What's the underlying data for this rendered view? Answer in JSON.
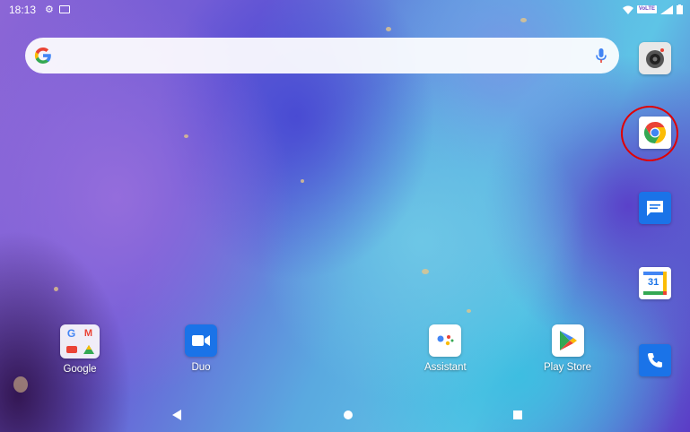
{
  "status_bar": {
    "time": "18:13",
    "icons": [
      "gear-icon",
      "message-icon",
      "wifi-icon",
      "volte-icon",
      "signal-icon",
      "battery-icon"
    ],
    "volte_label": "VoLTE"
  },
  "search": {
    "logo": "G",
    "icons": [
      "google-g-icon",
      "mic-icon"
    ]
  },
  "apps": {
    "google_folder": {
      "label": "Google"
    },
    "duo": {
      "label": "Duo"
    },
    "assistant": {
      "label": "Assistant"
    },
    "play_store": {
      "label": "Play Store"
    }
  },
  "dock": {
    "items": [
      "camera",
      "chrome",
      "messages",
      "calendar",
      "phone"
    ],
    "calendar_day": "31"
  },
  "nav": [
    "back-icon",
    "home-icon",
    "recents-icon"
  ],
  "colors": {
    "google_blue": "#4285F4",
    "google_red": "#EA4335",
    "google_yellow": "#FBBC05",
    "google_green": "#34A853",
    "highlight": "#e10000"
  }
}
